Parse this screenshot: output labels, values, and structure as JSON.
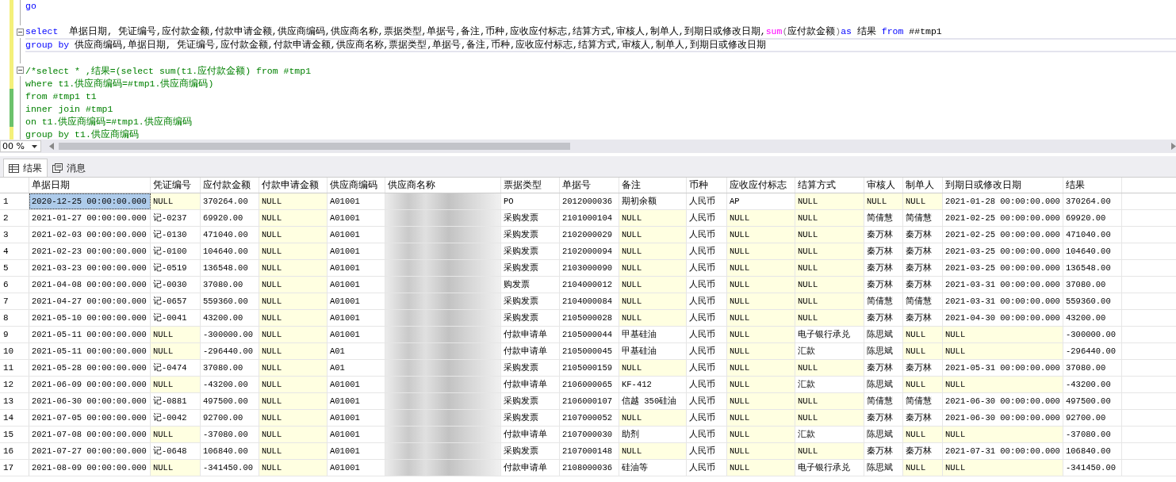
{
  "editor": {
    "lines": [
      {
        "saved": false,
        "fold": false,
        "segments": [
          {
            "kind": "keyword",
            "text": "go"
          }
        ]
      },
      {
        "saved": false,
        "fold": false
      },
      {
        "saved": false,
        "fold": true,
        "segments": [
          {
            "kind": "keyword",
            "text": "select"
          },
          {
            "kind": "plain",
            "text": "  单据日期, 凭证编号,应付款金额,付款申请金额,供应商编码,供应商名称,票据类型,单据号,备注,币种,应收应付标志,结算方式,审核人,制单人,到期日或修改日期,"
          },
          {
            "kind": "function",
            "text": "sum"
          },
          {
            "kind": "operator",
            "text": "("
          },
          {
            "kind": "plain",
            "text": "应付款金额"
          },
          {
            "kind": "operator",
            "text": ")"
          },
          {
            "kind": "keyword",
            "text": "as"
          },
          {
            "kind": "plain",
            "text": " 结果 "
          },
          {
            "kind": "keyword",
            "text": "from"
          },
          {
            "kind": "plain",
            "text": " ##tmp1"
          }
        ]
      },
      {
        "saved": false,
        "fold": false,
        "segments": [
          {
            "kind": "keyword",
            "text": "group by"
          },
          {
            "kind": "plain",
            "text": " 供应商编码,单据日期, 凭证编号,应付款金额,付款申请金额,供应商名称,票据类型,单据号,备注,币种,应收应付标志,结算方式,审核人,制单人,到期日或修改日期"
          }
        ]
      },
      {
        "saved": false,
        "fold": false
      },
      {
        "saved": false,
        "fold": true,
        "segments": [
          {
            "kind": "comment",
            "text": "/*select * ,结果=(select sum(t1.应付款金额) from #tmp1"
          }
        ]
      },
      {
        "saved": false,
        "fold": false,
        "segments": [
          {
            "kind": "comment",
            "text": "where t1.供应商编码=#tmp1.供应商编码)"
          }
        ]
      },
      {
        "saved": true,
        "fold": false,
        "segments": [
          {
            "kind": "comment",
            "text": "from #tmp1 t1"
          }
        ]
      },
      {
        "saved": true,
        "fold": false,
        "segments": [
          {
            "kind": "comment",
            "text": "inner join #tmp1"
          }
        ]
      },
      {
        "saved": true,
        "fold": false,
        "segments": [
          {
            "kind": "comment",
            "text": "on t1.供应商编码=#tmp1.供应商编码"
          }
        ]
      },
      {
        "saved": false,
        "fold": false,
        "segments": [
          {
            "kind": "comment",
            "text": "group by t1.供应商编码"
          }
        ]
      }
    ],
    "zoom": "00 %"
  },
  "tabs": [
    {
      "label": "结果",
      "selected": true
    },
    {
      "label": "消息",
      "selected": false
    }
  ],
  "grid": {
    "columns": [
      "单据日期",
      "凭证编号",
      "应付款金额",
      "付款申请金额",
      "供应商编码",
      "供应商名称",
      "票据类型",
      "单据号",
      "备注",
      "币种",
      "应收应付标志",
      "结算方式",
      "审核人",
      "制单人",
      "到期日或修改日期",
      "结果"
    ],
    "rows": [
      {
        "num": "1",
        "selected": true,
        "cells": [
          {
            "kind": "value",
            "text": "2020-12-25 00:00:00.000"
          },
          {
            "kind": "null",
            "text": "NULL"
          },
          {
            "kind": "value",
            "text": "370264.00"
          },
          {
            "kind": "null",
            "text": "NULL"
          },
          {
            "kind": "value",
            "text": "A01001"
          },
          {
            "kind": "blurred"
          },
          {
            "kind": "value",
            "text": "PO"
          },
          {
            "kind": "value",
            "text": "2012000036"
          },
          {
            "kind": "value",
            "text": "期初余额"
          },
          {
            "kind": "value",
            "text": "人民币"
          },
          {
            "kind": "value",
            "text": "AP"
          },
          {
            "kind": "null",
            "text": "NULL"
          },
          {
            "kind": "null",
            "text": "NULL"
          },
          {
            "kind": "null",
            "text": "NULL"
          },
          {
            "kind": "value",
            "text": "2021-01-28 00:00:00.000"
          },
          {
            "kind": "value",
            "text": "370264.00"
          }
        ]
      },
      {
        "num": "2",
        "selected": false,
        "cells": [
          {
            "kind": "value",
            "text": "2021-01-27 00:00:00.000"
          },
          {
            "kind": "value",
            "text": "记-0237"
          },
          {
            "kind": "value",
            "text": "69920.00"
          },
          {
            "kind": "null",
            "text": "NULL"
          },
          {
            "kind": "value",
            "text": "A01001"
          },
          {
            "kind": "blurred"
          },
          {
            "kind": "value",
            "text": "采购发票"
          },
          {
            "kind": "value",
            "text": "2101000104"
          },
          {
            "kind": "null",
            "text": "NULL"
          },
          {
            "kind": "value",
            "text": "人民币"
          },
          {
            "kind": "null",
            "text": "NULL"
          },
          {
            "kind": "null",
            "text": "NULL"
          },
          {
            "kind": "value",
            "text": "简倩慧"
          },
          {
            "kind": "value",
            "text": "简倩慧"
          },
          {
            "kind": "value",
            "text": "2021-02-25 00:00:00.000"
          },
          {
            "kind": "value",
            "text": "69920.00"
          }
        ]
      },
      {
        "num": "3",
        "selected": false,
        "cells": [
          {
            "kind": "value",
            "text": "2021-02-03 00:00:00.000"
          },
          {
            "kind": "value",
            "text": "记-0130"
          },
          {
            "kind": "value",
            "text": "471040.00"
          },
          {
            "kind": "null",
            "text": "NULL"
          },
          {
            "kind": "value",
            "text": "A01001"
          },
          {
            "kind": "blurred"
          },
          {
            "kind": "value",
            "text": "采购发票"
          },
          {
            "kind": "value",
            "text": "2102000029"
          },
          {
            "kind": "null",
            "text": "NULL"
          },
          {
            "kind": "value",
            "text": "人民币"
          },
          {
            "kind": "null",
            "text": "NULL"
          },
          {
            "kind": "null",
            "text": "NULL"
          },
          {
            "kind": "value",
            "text": "秦万林"
          },
          {
            "kind": "value",
            "text": "秦万林"
          },
          {
            "kind": "value",
            "text": "2021-02-25 00:00:00.000"
          },
          {
            "kind": "value",
            "text": "471040.00"
          }
        ]
      },
      {
        "num": "4",
        "selected": false,
        "cells": [
          {
            "kind": "value",
            "text": "2021-02-23 00:00:00.000"
          },
          {
            "kind": "value",
            "text": "记-0100"
          },
          {
            "kind": "value",
            "text": "104640.00"
          },
          {
            "kind": "null",
            "text": "NULL"
          },
          {
            "kind": "value",
            "text": "A01001"
          },
          {
            "kind": "blurred"
          },
          {
            "kind": "value",
            "text": "采购发票"
          },
          {
            "kind": "value",
            "text": "2102000094"
          },
          {
            "kind": "null",
            "text": "NULL"
          },
          {
            "kind": "value",
            "text": "人民币"
          },
          {
            "kind": "null",
            "text": "NULL"
          },
          {
            "kind": "null",
            "text": "NULL"
          },
          {
            "kind": "value",
            "text": "秦万林"
          },
          {
            "kind": "value",
            "text": "秦万林"
          },
          {
            "kind": "value",
            "text": "2021-03-25 00:00:00.000"
          },
          {
            "kind": "value",
            "text": "104640.00"
          }
        ]
      },
      {
        "num": "5",
        "selected": false,
        "cells": [
          {
            "kind": "value",
            "text": "2021-03-23 00:00:00.000"
          },
          {
            "kind": "value",
            "text": "记-0519"
          },
          {
            "kind": "value",
            "text": "136548.00"
          },
          {
            "kind": "null",
            "text": "NULL"
          },
          {
            "kind": "value",
            "text": "A01001"
          },
          {
            "kind": "blurred"
          },
          {
            "kind": "value",
            "text": "采购发票"
          },
          {
            "kind": "value",
            "text": "2103000090"
          },
          {
            "kind": "null",
            "text": "NULL"
          },
          {
            "kind": "value",
            "text": "人民币"
          },
          {
            "kind": "null",
            "text": "NULL"
          },
          {
            "kind": "null",
            "text": "NULL"
          },
          {
            "kind": "value",
            "text": "秦万林"
          },
          {
            "kind": "value",
            "text": "秦万林"
          },
          {
            "kind": "value",
            "text": "2021-03-25 00:00:00.000"
          },
          {
            "kind": "value",
            "text": "136548.00"
          }
        ]
      },
      {
        "num": "6",
        "selected": false,
        "cells": [
          {
            "kind": "value",
            "text": "2021-04-08 00:00:00.000"
          },
          {
            "kind": "value",
            "text": "记-0030"
          },
          {
            "kind": "value",
            "text": "37080.00"
          },
          {
            "kind": "null",
            "text": "NULL"
          },
          {
            "kind": "value",
            "text": "A01001"
          },
          {
            "kind": "blurred"
          },
          {
            "kind": "value",
            "text": "购发票"
          },
          {
            "kind": "value",
            "text": "2104000012"
          },
          {
            "kind": "null",
            "text": "NULL"
          },
          {
            "kind": "value",
            "text": "人民币"
          },
          {
            "kind": "null",
            "text": "NULL"
          },
          {
            "kind": "null",
            "text": "NULL"
          },
          {
            "kind": "value",
            "text": "秦万林"
          },
          {
            "kind": "value",
            "text": "秦万林"
          },
          {
            "kind": "value",
            "text": "2021-03-31 00:00:00.000"
          },
          {
            "kind": "value",
            "text": "37080.00"
          }
        ]
      },
      {
        "num": "7",
        "selected": false,
        "cells": [
          {
            "kind": "value",
            "text": "2021-04-27 00:00:00.000"
          },
          {
            "kind": "value",
            "text": "记-0657"
          },
          {
            "kind": "value",
            "text": "559360.00"
          },
          {
            "kind": "null",
            "text": "NULL"
          },
          {
            "kind": "value",
            "text": "A01001"
          },
          {
            "kind": "blurred"
          },
          {
            "kind": "value",
            "text": "采购发票"
          },
          {
            "kind": "value",
            "text": "2104000084"
          },
          {
            "kind": "null",
            "text": "NULL"
          },
          {
            "kind": "value",
            "text": "人民币"
          },
          {
            "kind": "null",
            "text": "NULL"
          },
          {
            "kind": "null",
            "text": "NULL"
          },
          {
            "kind": "value",
            "text": "简倩慧"
          },
          {
            "kind": "value",
            "text": "简倩慧"
          },
          {
            "kind": "value",
            "text": "2021-03-31 00:00:00.000"
          },
          {
            "kind": "value",
            "text": "559360.00"
          }
        ]
      },
      {
        "num": "8",
        "selected": false,
        "cells": [
          {
            "kind": "value",
            "text": "2021-05-10 00:00:00.000"
          },
          {
            "kind": "value",
            "text": "记-0041"
          },
          {
            "kind": "value",
            "text": "43200.00"
          },
          {
            "kind": "null",
            "text": "NULL"
          },
          {
            "kind": "value",
            "text": "A01001"
          },
          {
            "kind": "blurred"
          },
          {
            "kind": "value",
            "text": "采购发票"
          },
          {
            "kind": "value",
            "text": "2105000028"
          },
          {
            "kind": "null",
            "text": "NULL"
          },
          {
            "kind": "value",
            "text": "人民币"
          },
          {
            "kind": "null",
            "text": "NULL"
          },
          {
            "kind": "null",
            "text": "NULL"
          },
          {
            "kind": "value",
            "text": "秦万林"
          },
          {
            "kind": "value",
            "text": "秦万林"
          },
          {
            "kind": "value",
            "text": "2021-04-30 00:00:00.000"
          },
          {
            "kind": "value",
            "text": "43200.00"
          }
        ]
      },
      {
        "num": "9",
        "selected": false,
        "cells": [
          {
            "kind": "value",
            "text": "2021-05-11 00:00:00.000"
          },
          {
            "kind": "null",
            "text": "NULL"
          },
          {
            "kind": "value",
            "text": "-300000.00"
          },
          {
            "kind": "null",
            "text": "NULL"
          },
          {
            "kind": "value",
            "text": "A01001"
          },
          {
            "kind": "blurred"
          },
          {
            "kind": "value",
            "text": "付款申请单"
          },
          {
            "kind": "value",
            "text": "2105000044"
          },
          {
            "kind": "value",
            "text": "甲基硅油"
          },
          {
            "kind": "value",
            "text": "人民币"
          },
          {
            "kind": "null",
            "text": "NULL"
          },
          {
            "kind": "value",
            "text": "电子银行承兑"
          },
          {
            "kind": "value",
            "text": "陈思斌"
          },
          {
            "kind": "null",
            "text": "NULL"
          },
          {
            "kind": "null",
            "text": "NULL"
          },
          {
            "kind": "value",
            "text": "-300000.00"
          }
        ]
      },
      {
        "num": "10",
        "selected": false,
        "cells": [
          {
            "kind": "value",
            "text": "2021-05-11 00:00:00.000"
          },
          {
            "kind": "null",
            "text": "NULL"
          },
          {
            "kind": "value",
            "text": "-296440.00"
          },
          {
            "kind": "null",
            "text": "NULL"
          },
          {
            "kind": "value",
            "text": "A01"
          },
          {
            "kind": "blurred"
          },
          {
            "kind": "value",
            "text": "付款申请单"
          },
          {
            "kind": "value",
            "text": "2105000045"
          },
          {
            "kind": "value",
            "text": "甲基硅油"
          },
          {
            "kind": "value",
            "text": "人民币"
          },
          {
            "kind": "null",
            "text": "NULL"
          },
          {
            "kind": "value",
            "text": "汇款"
          },
          {
            "kind": "value",
            "text": "陈思斌"
          },
          {
            "kind": "null",
            "text": "NULL"
          },
          {
            "kind": "null",
            "text": "NULL"
          },
          {
            "kind": "value",
            "text": "-296440.00"
          }
        ]
      },
      {
        "num": "11",
        "selected": false,
        "cells": [
          {
            "kind": "value",
            "text": "2021-05-28 00:00:00.000"
          },
          {
            "kind": "value",
            "text": "记-0474"
          },
          {
            "kind": "value",
            "text": "37080.00"
          },
          {
            "kind": "null",
            "text": "NULL"
          },
          {
            "kind": "value",
            "text": "A01"
          },
          {
            "kind": "blurred"
          },
          {
            "kind": "value",
            "text": "采购发票"
          },
          {
            "kind": "value",
            "text": "2105000159"
          },
          {
            "kind": "null",
            "text": "NULL"
          },
          {
            "kind": "value",
            "text": "人民币"
          },
          {
            "kind": "null",
            "text": "NULL"
          },
          {
            "kind": "null",
            "text": "NULL"
          },
          {
            "kind": "value",
            "text": "秦万林"
          },
          {
            "kind": "value",
            "text": "秦万林"
          },
          {
            "kind": "value",
            "text": "2021-05-31 00:00:00.000"
          },
          {
            "kind": "value",
            "text": "37080.00"
          }
        ]
      },
      {
        "num": "12",
        "selected": false,
        "cells": [
          {
            "kind": "value",
            "text": "2021-06-09 00:00:00.000"
          },
          {
            "kind": "null",
            "text": "NULL"
          },
          {
            "kind": "value",
            "text": "-43200.00"
          },
          {
            "kind": "null",
            "text": "NULL"
          },
          {
            "kind": "value",
            "text": "A01001"
          },
          {
            "kind": "blurred"
          },
          {
            "kind": "value",
            "text": "付款申请单"
          },
          {
            "kind": "value",
            "text": "2106000065"
          },
          {
            "kind": "value",
            "text": "KF-412"
          },
          {
            "kind": "value",
            "text": "人民币"
          },
          {
            "kind": "null",
            "text": "NULL"
          },
          {
            "kind": "value",
            "text": "汇款"
          },
          {
            "kind": "value",
            "text": "陈思斌"
          },
          {
            "kind": "null",
            "text": "NULL"
          },
          {
            "kind": "null",
            "text": "NULL"
          },
          {
            "kind": "value",
            "text": "-43200.00"
          }
        ]
      },
      {
        "num": "13",
        "selected": false,
        "cells": [
          {
            "kind": "value",
            "text": "2021-06-30 00:00:00.000"
          },
          {
            "kind": "value",
            "text": "记-0881"
          },
          {
            "kind": "value",
            "text": "497500.00"
          },
          {
            "kind": "null",
            "text": "NULL"
          },
          {
            "kind": "value",
            "text": "A01001"
          },
          {
            "kind": "blurred"
          },
          {
            "kind": "value",
            "text": "采购发票"
          },
          {
            "kind": "value",
            "text": "2106000107"
          },
          {
            "kind": "value",
            "text": "信越 350硅油"
          },
          {
            "kind": "value",
            "text": "人民币"
          },
          {
            "kind": "null",
            "text": "NULL"
          },
          {
            "kind": "null",
            "text": "NULL"
          },
          {
            "kind": "value",
            "text": "简倩慧"
          },
          {
            "kind": "value",
            "text": "简倩慧"
          },
          {
            "kind": "value",
            "text": "2021-06-30 00:00:00.000"
          },
          {
            "kind": "value",
            "text": "497500.00"
          }
        ]
      },
      {
        "num": "14",
        "selected": false,
        "cells": [
          {
            "kind": "value",
            "text": "2021-07-05 00:00:00.000"
          },
          {
            "kind": "value",
            "text": "记-0042"
          },
          {
            "kind": "value",
            "text": "92700.00"
          },
          {
            "kind": "null",
            "text": "NULL"
          },
          {
            "kind": "value",
            "text": "A01001"
          },
          {
            "kind": "blurred"
          },
          {
            "kind": "value",
            "text": "采购发票"
          },
          {
            "kind": "value",
            "text": "2107000052"
          },
          {
            "kind": "null",
            "text": "NULL"
          },
          {
            "kind": "value",
            "text": "人民币"
          },
          {
            "kind": "null",
            "text": "NULL"
          },
          {
            "kind": "null",
            "text": "NULL"
          },
          {
            "kind": "value",
            "text": "秦万林"
          },
          {
            "kind": "value",
            "text": "秦万林"
          },
          {
            "kind": "value",
            "text": "2021-06-30 00:00:00.000"
          },
          {
            "kind": "value",
            "text": "92700.00"
          }
        ]
      },
      {
        "num": "15",
        "selected": false,
        "cells": [
          {
            "kind": "value",
            "text": "2021-07-08 00:00:00.000"
          },
          {
            "kind": "null",
            "text": "NULL"
          },
          {
            "kind": "value",
            "text": "-37080.00"
          },
          {
            "kind": "null",
            "text": "NULL"
          },
          {
            "kind": "value",
            "text": "A01001"
          },
          {
            "kind": "blurred"
          },
          {
            "kind": "value",
            "text": "付款申请单"
          },
          {
            "kind": "value",
            "text": "2107000030"
          },
          {
            "kind": "value",
            "text": "助剂"
          },
          {
            "kind": "value",
            "text": "人民币"
          },
          {
            "kind": "null",
            "text": "NULL"
          },
          {
            "kind": "value",
            "text": "汇款"
          },
          {
            "kind": "value",
            "text": "陈思斌"
          },
          {
            "kind": "null",
            "text": "NULL"
          },
          {
            "kind": "null",
            "text": "NULL"
          },
          {
            "kind": "value",
            "text": "-37080.00"
          }
        ]
      },
      {
        "num": "16",
        "selected": false,
        "cells": [
          {
            "kind": "value",
            "text": "2021-07-27 00:00:00.000"
          },
          {
            "kind": "value",
            "text": "记-0648"
          },
          {
            "kind": "value",
            "text": "106840.00"
          },
          {
            "kind": "null",
            "text": "NULL"
          },
          {
            "kind": "value",
            "text": "A01001"
          },
          {
            "kind": "blurred"
          },
          {
            "kind": "value",
            "text": "采购发票"
          },
          {
            "kind": "value",
            "text": "2107000148"
          },
          {
            "kind": "null",
            "text": "NULL"
          },
          {
            "kind": "value",
            "text": "人民币"
          },
          {
            "kind": "null",
            "text": "NULL"
          },
          {
            "kind": "null",
            "text": "NULL"
          },
          {
            "kind": "value",
            "text": "秦万林"
          },
          {
            "kind": "value",
            "text": "秦万林"
          },
          {
            "kind": "value",
            "text": "2021-07-31 00:00:00.000"
          },
          {
            "kind": "value",
            "text": "106840.00"
          }
        ]
      },
      {
        "num": "17",
        "selected": false,
        "cells": [
          {
            "kind": "value",
            "text": "2021-08-09 00:00:00.000"
          },
          {
            "kind": "null",
            "text": "NULL"
          },
          {
            "kind": "value",
            "text": "-341450.00"
          },
          {
            "kind": "null",
            "text": "NULL"
          },
          {
            "kind": "value",
            "text": "A01001"
          },
          {
            "kind": "blurred"
          },
          {
            "kind": "value",
            "text": "付款申请单"
          },
          {
            "kind": "value",
            "text": "2108000036"
          },
          {
            "kind": "value",
            "text": "硅油等"
          },
          {
            "kind": "value",
            "text": "人民币"
          },
          {
            "kind": "null",
            "text": "NULL"
          },
          {
            "kind": "value",
            "text": "电子银行承兑"
          },
          {
            "kind": "value",
            "text": "陈思斌"
          },
          {
            "kind": "null",
            "text": "NULL"
          },
          {
            "kind": "null",
            "text": "NULL"
          },
          {
            "kind": "value",
            "text": "-341450.00"
          }
        ]
      }
    ]
  }
}
